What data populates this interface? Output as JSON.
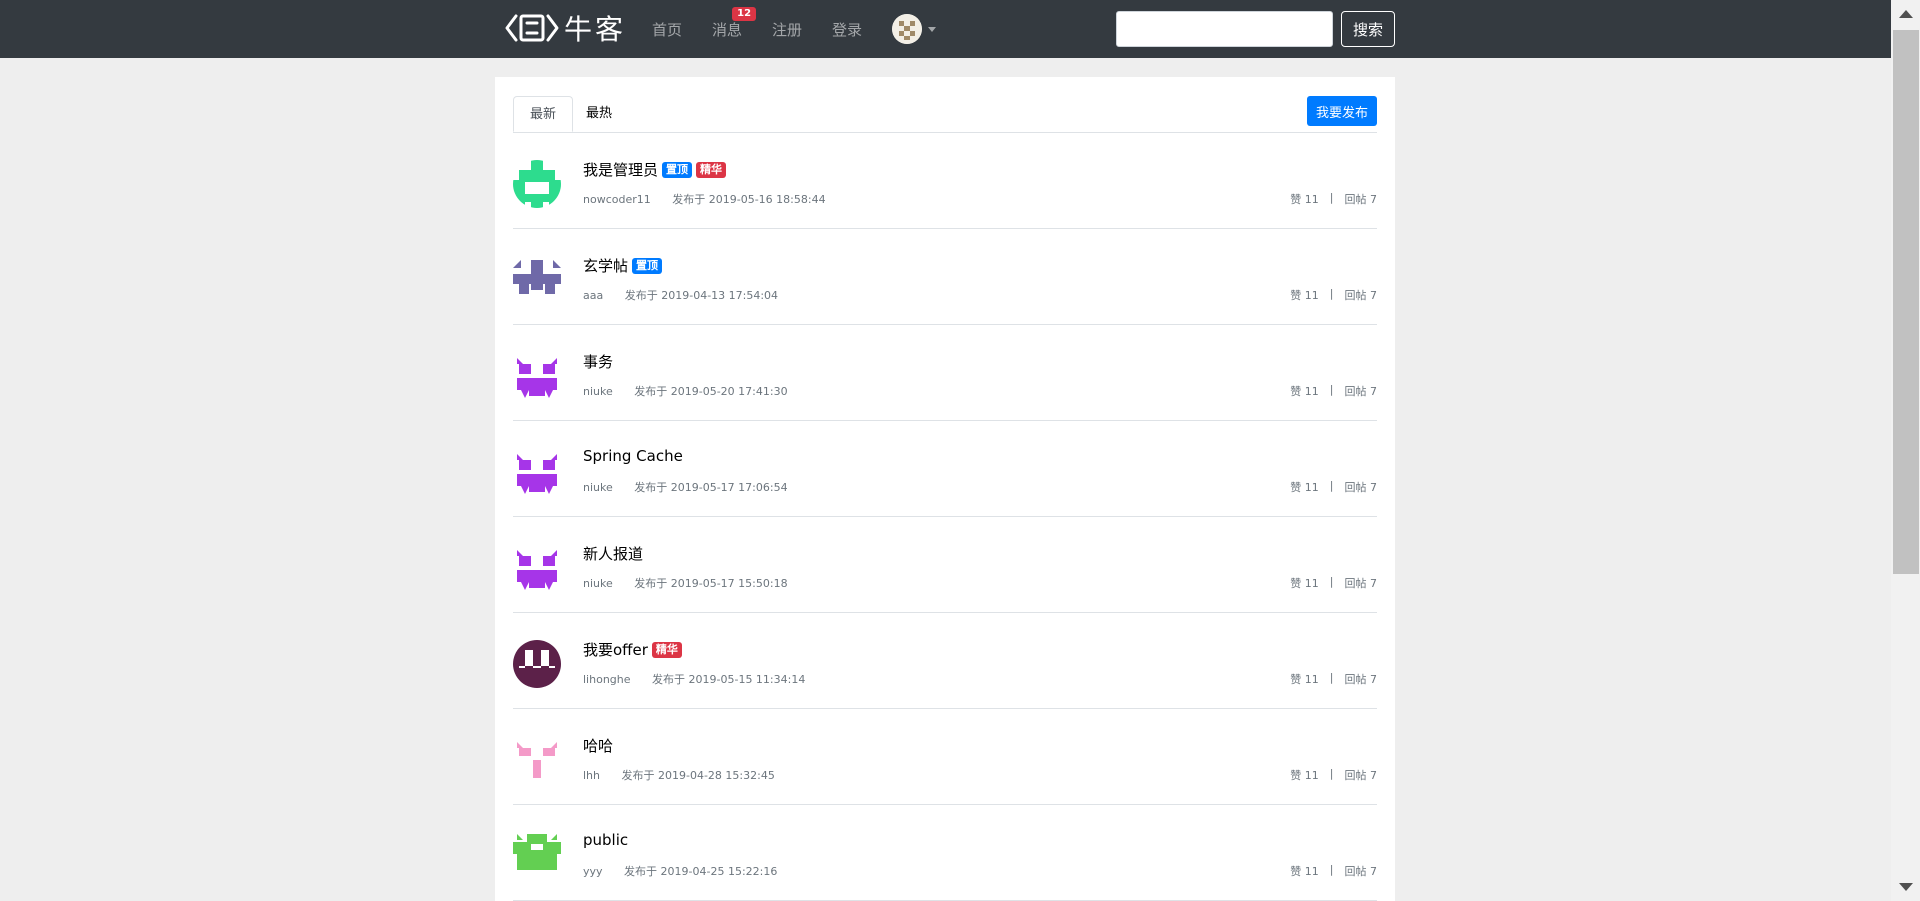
{
  "navbar": {
    "logo_text": "牛客",
    "links": [
      {
        "label": "首页"
      },
      {
        "label": "消息",
        "badge": "12"
      },
      {
        "label": "注册"
      },
      {
        "label": "登录"
      }
    ],
    "search": {
      "value": "",
      "button_label": "搜索"
    }
  },
  "main": {
    "tabs": [
      {
        "label": "最新",
        "active": true
      },
      {
        "label": "最热",
        "active": false
      }
    ],
    "publish_label": "我要发布",
    "posts": [
      {
        "title": "我是管理员",
        "tags": [
          "置顶",
          "精华"
        ],
        "author": "nowcoder11",
        "published": "发布于 2019-05-16 18:58:44",
        "likes": "赞 11",
        "replies": "回帖 7",
        "avatar_icon": "identicon-green",
        "avatar_color": "#2ddc8e"
      },
      {
        "title": "玄学帖",
        "tags": [
          "置顶"
        ],
        "author": "aaa",
        "published": "发布于 2019-04-13 17:54:04",
        "likes": "赞 11",
        "replies": "回帖 7",
        "avatar_icon": "identicon-slate",
        "avatar_color": "#6f69a8"
      },
      {
        "title": "事务",
        "tags": [],
        "author": "niuke",
        "published": "发布于 2019-05-20 17:41:30",
        "likes": "赞 11",
        "replies": "回帖 7",
        "avatar_icon": "identicon-purple",
        "avatar_color": "#a635e8"
      },
      {
        "title": "Spring Cache",
        "tags": [],
        "author": "niuke",
        "published": "发布于 2019-05-17 17:06:54",
        "likes": "赞 11",
        "replies": "回帖 7",
        "avatar_icon": "identicon-purple",
        "avatar_color": "#a635e8"
      },
      {
        "title": "新人报道",
        "tags": [],
        "author": "niuke",
        "published": "发布于 2019-05-17 15:50:18",
        "likes": "赞 11",
        "replies": "回帖 7",
        "avatar_icon": "identicon-purple",
        "avatar_color": "#a635e8"
      },
      {
        "title": "我要offer",
        "tags": [
          "精华"
        ],
        "author": "lihonghe",
        "published": "发布于 2019-05-15 11:34:14",
        "likes": "赞 11",
        "replies": "回帖 7",
        "avatar_icon": "identicon-maroon",
        "avatar_color": "#5c2149"
      },
      {
        "title": "哈哈",
        "tags": [],
        "author": "lhh",
        "published": "发布于 2019-04-28 15:32:45",
        "likes": "赞 11",
        "replies": "回帖 7",
        "avatar_icon": "identicon-pink",
        "avatar_color": "#f49ac8"
      },
      {
        "title": "public",
        "tags": [],
        "author": "yyy",
        "published": "发布于 2019-04-25 15:22:16",
        "likes": "赞 11",
        "replies": "回帖 7",
        "avatar_icon": "identicon-lime",
        "avatar_color": "#63cf52"
      }
    ]
  },
  "colors": {
    "navbar": "#343a40",
    "primary": "#007bff",
    "danger": "#dc3545",
    "muted": "#6c757d"
  }
}
